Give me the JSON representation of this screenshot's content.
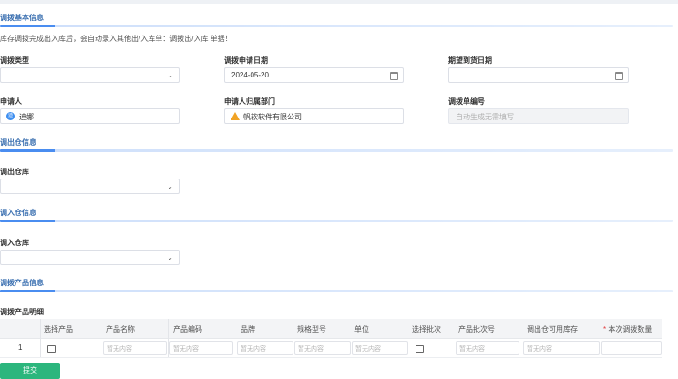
{
  "sections": {
    "basic": "调拨基本信息",
    "out_warehouse": "调出仓信息",
    "in_warehouse": "调入仓信息",
    "products": "调拨产品信息"
  },
  "notice": "库存调拨完成出入库后，会自动录入其他出/入库单：调拨出/入库 单据！",
  "form": {
    "transfer_type_label": "调拨类型",
    "transfer_type_value": "",
    "apply_date_label": "调拨申请日期",
    "apply_date_value": "2024-05-20",
    "expected_date_label": "期望到货日期",
    "expected_date_value": "",
    "applicant_label": "申请人",
    "applicant_value": "迪娜",
    "applicant_avatar": "迪",
    "dept_label": "申请人归属部门",
    "dept_value": "帆软软件有限公司",
    "number_label": "调拨单编号",
    "number_placeholder": "自动生成无需填写",
    "out_warehouse_label": "调出仓库",
    "out_warehouse_value": "",
    "in_warehouse_label": "调入仓库",
    "in_warehouse_value": ""
  },
  "table": {
    "title": "调拨产品明细",
    "headers": [
      "选择产品",
      "产品名称",
      "产品编码",
      "品牌",
      "规格型号",
      "单位",
      "选择批次",
      "产品批次号",
      "调出仓可用库存",
      "本次调拨数量"
    ],
    "required_mark": "*",
    "row_index": "1",
    "empty_text": "暂无内容"
  },
  "submit_label": "提交",
  "icons": [
    "chevron-down-icon",
    "calendar-icon",
    "user-avatar-icon",
    "warning-icon",
    "picker-icon"
  ]
}
